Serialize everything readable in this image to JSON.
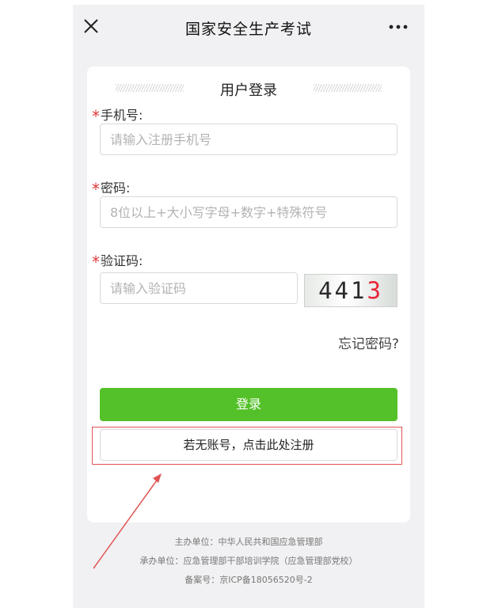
{
  "nav": {
    "title": "国家安全生产考试"
  },
  "form": {
    "title": "用户登录",
    "phone": {
      "label": "手机号:",
      "placeholder": "请输入注册手机号"
    },
    "password": {
      "label": "密码:",
      "placeholder": "8位以上+大小写字母+数字+特殊符号"
    },
    "captcha": {
      "label": "验证码:",
      "placeholder": "请输入验证码",
      "code_main": "441",
      "code_last": "3"
    },
    "required_mark": "*",
    "forgot_label": "忘记密码?",
    "login_label": "登录",
    "register_label": "若无账号，点击此处注册"
  },
  "footer": {
    "sponsor": "主办单位：中华人民共和国应急管理部",
    "organizer": "承办单位：应急管理部干部培训学院（应急管理部党校）",
    "icp": "备案号：京ICP备18056520号-2"
  },
  "colors": {
    "primary_green": "#55c12a",
    "required_red": "#e03a3a",
    "annotation_red": "#e05454"
  }
}
